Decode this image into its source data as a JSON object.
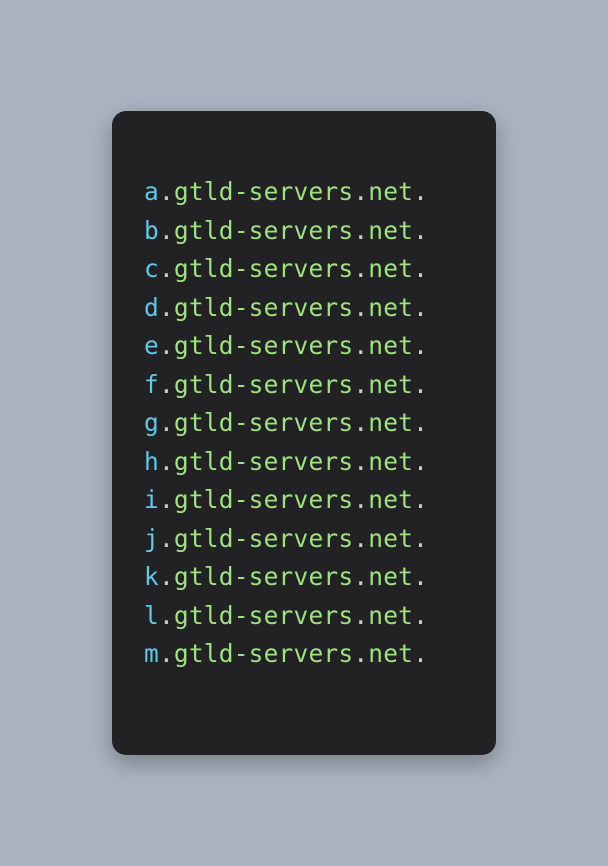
{
  "entries": [
    {
      "prefix": "a",
      "domain": "gtld-servers",
      "tld": "net"
    },
    {
      "prefix": "b",
      "domain": "gtld-servers",
      "tld": "net"
    },
    {
      "prefix": "c",
      "domain": "gtld-servers",
      "tld": "net"
    },
    {
      "prefix": "d",
      "domain": "gtld-servers",
      "tld": "net"
    },
    {
      "prefix": "e",
      "domain": "gtld-servers",
      "tld": "net"
    },
    {
      "prefix": "f",
      "domain": "gtld-servers",
      "tld": "net"
    },
    {
      "prefix": "g",
      "domain": "gtld-servers",
      "tld": "net"
    },
    {
      "prefix": "h",
      "domain": "gtld-servers",
      "tld": "net"
    },
    {
      "prefix": "i",
      "domain": "gtld-servers",
      "tld": "net"
    },
    {
      "prefix": "j",
      "domain": "gtld-servers",
      "tld": "net"
    },
    {
      "prefix": "k",
      "domain": "gtld-servers",
      "tld": "net"
    },
    {
      "prefix": "l",
      "domain": "gtld-servers",
      "tld": "net"
    },
    {
      "prefix": "m",
      "domain": "gtld-servers",
      "tld": "net"
    }
  ],
  "separator": "."
}
